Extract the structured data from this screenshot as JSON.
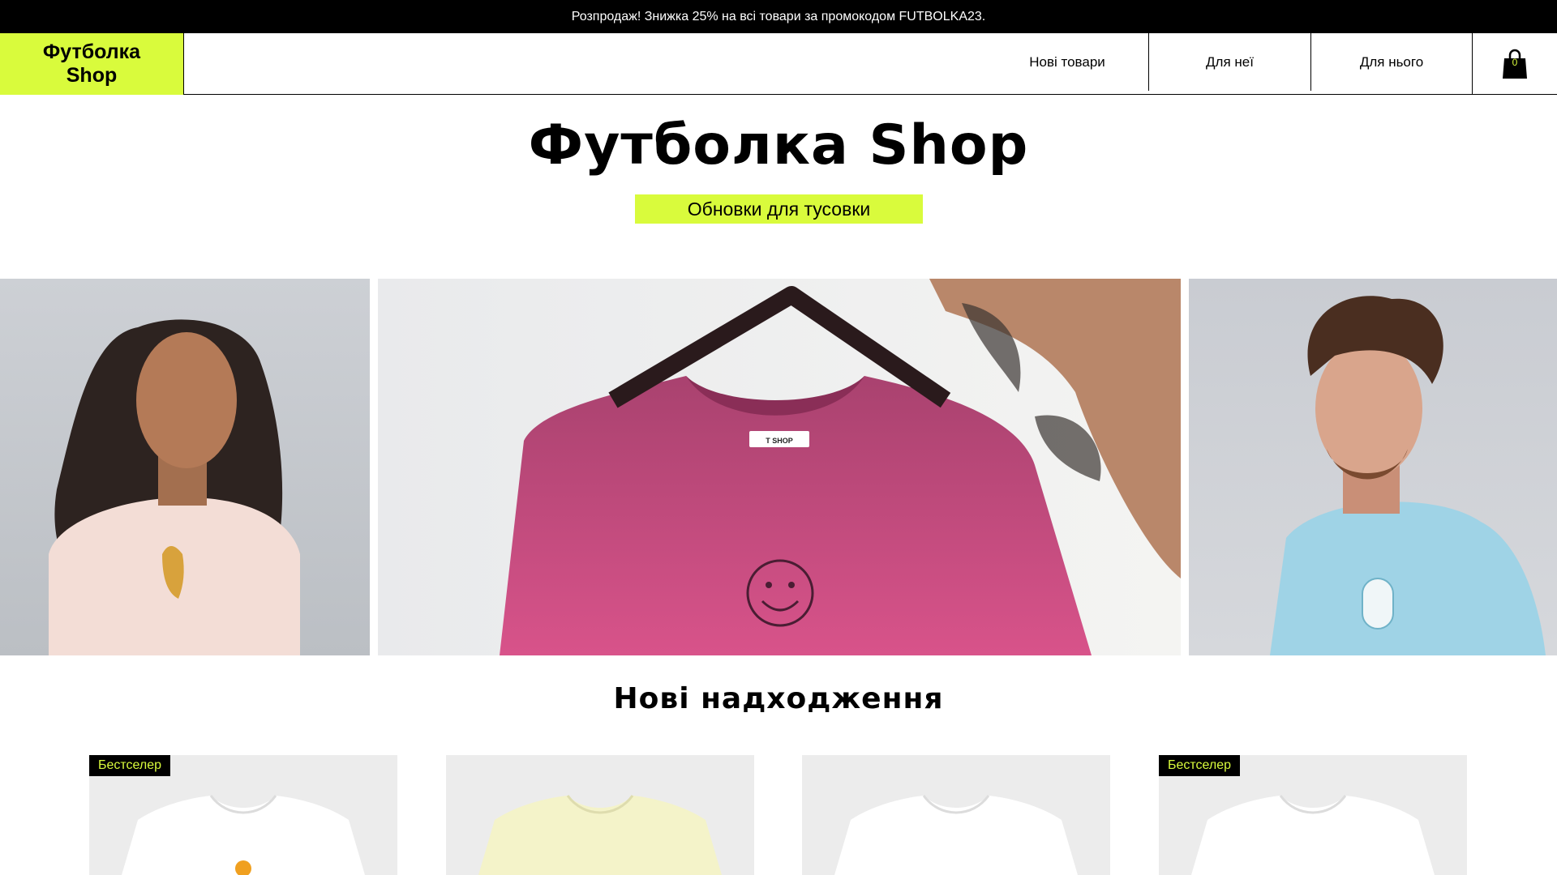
{
  "promo": {
    "text": "Розпродаж! Знижка 25% на всі товари за промокодом FUTBOLKA23."
  },
  "header": {
    "logo": "Футболка Shop",
    "nav": [
      {
        "label": "Нові товари"
      },
      {
        "label": "Для неї"
      },
      {
        "label": "Для нього"
      }
    ],
    "cart_count": "0"
  },
  "hero": {
    "title": "Футболка Shop",
    "subtitle": "Обновки для тусовки",
    "shirt_label": "T SHOP"
  },
  "new_arrivals": {
    "title": "Нові надходження",
    "products": [
      {
        "badge": "Бестселер",
        "shirt_color": "#ffffff"
      },
      {
        "badge": "",
        "shirt_color": "#f4f3c9"
      },
      {
        "badge": "",
        "shirt_color": "#ffffff"
      },
      {
        "badge": "Бестселер",
        "shirt_color": "#ffffff"
      }
    ]
  },
  "colors": {
    "accent": "#d9fb3c",
    "promo_bg": "#000000",
    "hero_shirt": "#c8457e",
    "him_shirt": "#9fd3e6",
    "her_shirt": "#f3ddd6"
  }
}
